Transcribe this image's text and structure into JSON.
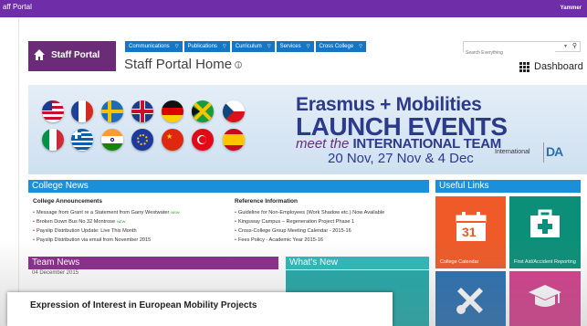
{
  "topbar": {
    "title": "aff Portal",
    "yammer": "Yammer"
  },
  "logo": {
    "label": "Staff Portal",
    "icon": "home-icon"
  },
  "nav": [
    {
      "label": "Communications"
    },
    {
      "label": "Publications"
    },
    {
      "label": "Curriculum"
    },
    {
      "label": "Services"
    },
    {
      "label": "Cross College"
    }
  ],
  "page": {
    "title": "Staff Portal Home",
    "info_icon": "i"
  },
  "search": {
    "placeholder": "Search Everything",
    "icon": "search-icon"
  },
  "dashboard": {
    "label": "Dashboard",
    "icon": "grid-icon"
  },
  "banner": {
    "title_line1": "Erasmus + Mobilities",
    "title_line2": "LAUNCH EVENTS",
    "meet_prefix": "meet the",
    "meet_team": "INTERNATIONAL TEAM",
    "dates": "20 Nov, 27 Nov & 4 Dec",
    "international": "International",
    "logo_text": "DA"
  },
  "college_news": {
    "heading": "College News",
    "announcements": {
      "heading": "College Announcements",
      "items": [
        {
          "text": "Message from Grant re a Statement from Garry Westwater",
          "new": "NEW"
        },
        {
          "text": "Broken Down Bus No 32 Montrose",
          "new": "NEW"
        },
        {
          "text": "Payslip Distribution Update: Live This Month",
          "new": ""
        },
        {
          "text": "Payslip Distribution via email from November 2015",
          "new": ""
        }
      ]
    },
    "reference": {
      "heading": "Reference Information",
      "items": [
        {
          "text": "Guideline for Non-Employees (Work Shadow etc.) Now Available"
        },
        {
          "text": "Kingsway Campus – Regeneration Project Phase 1"
        },
        {
          "text": "Cross-College Group Meeting Calendar - 2015-16"
        },
        {
          "text": "Fees Policy - Academic Year 2015-16"
        }
      ]
    }
  },
  "useful_links": {
    "heading": "Useful Links",
    "tiles": [
      {
        "label": "College Calendar",
        "icon": "calendar-icon",
        "day": "31",
        "color": "#ef5a28"
      },
      {
        "label": "First Aid/Accident Reporting",
        "icon": "first-aid-icon",
        "color": "#0c8f78"
      },
      {
        "label": "",
        "icon": "tools-icon",
        "color": "#2a6fb0"
      },
      {
        "label": "",
        "icon": "graduation-cap-icon",
        "color": "#d33f8c"
      }
    ]
  },
  "team_news": {
    "heading": "Team News",
    "first_item": "04 December 2015"
  },
  "whats_new": {
    "heading": "What's New"
  },
  "popup": {
    "text": "Expression of Interest in European Mobility Projects"
  },
  "colors": {
    "purple": "#6f2da8",
    "nav_blue": "#1576c4",
    "section_blue": "#1b8fd9",
    "team_purple": "#8a2c8c",
    "teal": "#2db9ba"
  }
}
